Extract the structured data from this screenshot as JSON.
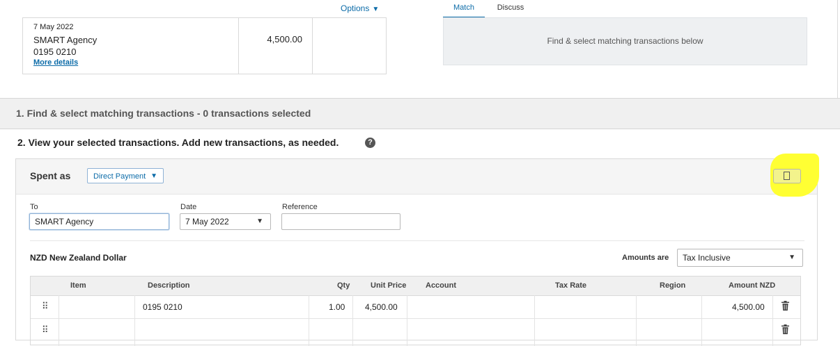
{
  "statement": {
    "options_label": "Options",
    "date": "7 May 2022",
    "payee": "SMART Agency",
    "reference": "0195 0210",
    "more_details": "More details",
    "amount": "4,500.00"
  },
  "tabs": [
    {
      "label": "Match",
      "active": true
    },
    {
      "label": "Discuss",
      "active": false
    }
  ],
  "match_panel_text": "Find & select matching transactions below",
  "section1_title": "1. Find & select matching transactions - 0 transactions selected",
  "section2_title": "2. View your selected transactions. Add new transactions, as needed.",
  "transaction": {
    "spent_as_label": "Spent as",
    "spent_as_value": "Direct Payment",
    "to_label": "To",
    "to_value": "SMART Agency",
    "date_label": "Date",
    "date_value": "7 May 2022",
    "reference_label": "Reference",
    "reference_value": "",
    "currency": "NZD New Zealand Dollar",
    "amounts_are_label": "Amounts are",
    "amounts_are_value": "Tax Inclusive"
  },
  "table": {
    "columns": [
      "Item",
      "Description",
      "Qty",
      "Unit Price",
      "Account",
      "Tax Rate",
      "Region",
      "Amount NZD"
    ],
    "rows": [
      {
        "item": "",
        "description": "0195 0210",
        "qty": "1.00",
        "unit_price": "4,500.00",
        "account": "",
        "tax_rate": "",
        "region": "",
        "amount": "4,500.00"
      },
      {
        "item": "",
        "description": "",
        "qty": "",
        "unit_price": "",
        "account": "",
        "tax_rate": "",
        "region": "",
        "amount": ""
      }
    ]
  },
  "colors": {
    "accent": "#0b6ba8",
    "highlight": "#ffff33",
    "section_bg": "#f0f0f0"
  },
  "icons": {
    "options_caret": "caret-down-icon",
    "help": "help-icon",
    "attach": "attach-file-icon",
    "drag": "drag-handle-icon",
    "delete": "trash-icon"
  }
}
